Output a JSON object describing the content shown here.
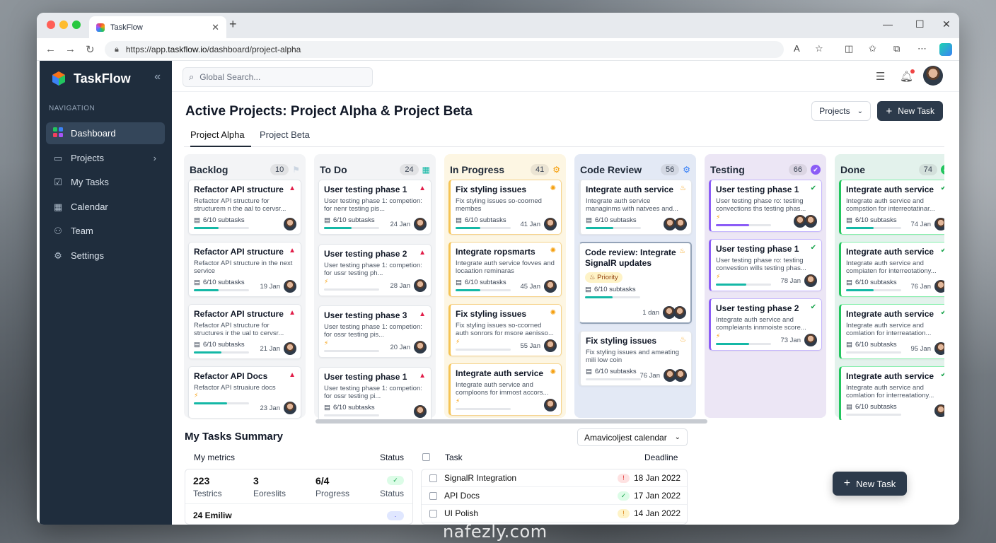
{
  "browser": {
    "tab_title": "TaskFlow",
    "url_prefix": "https://app.",
    "url_domain": "taskflow.io",
    "url_path": "/dashboard/project-alpha"
  },
  "sidebar": {
    "brand": "TaskFlow",
    "section_label": "NAVIGATION",
    "items": [
      {
        "label": "Dashboard",
        "icon": "grid-icon"
      },
      {
        "label": "Projects",
        "icon": "folder-icon"
      },
      {
        "label": "My Tasks",
        "icon": "checkbox-icon"
      },
      {
        "label": "Calendar",
        "icon": "calendar-icon"
      },
      {
        "label": "Team",
        "icon": "people-icon"
      },
      {
        "label": "Settings",
        "icon": "gear-icon"
      }
    ]
  },
  "topbar": {
    "search_placeholder": "Global Search..."
  },
  "page": {
    "title": "Active Projects: Project Alpha & Project Beta",
    "projects_select": "Projects",
    "new_task": "New Task",
    "tabs": [
      "Project Alpha",
      "Project Beta"
    ]
  },
  "columns": [
    {
      "title": "Backlog",
      "count": "10",
      "accent": "#f3f4f6",
      "cards": [
        {
          "title": "Refactor API structure",
          "desc": "Refactor API structure for structurem n the aal to cervsr...",
          "sub": "6/10 subtasks",
          "date": "",
          "progress": 0.45
        },
        {
          "title": "Refactor API structure",
          "desc": "Refactor API structure in the next service",
          "sub": "6/10 subtasks",
          "date": "19 Jan",
          "progress": 0.45
        },
        {
          "title": "Refactor API structure",
          "desc": "Refactor API structure for structures ir the ual to cervsr...",
          "sub": "6/10 subtasks",
          "date": "21 Jan",
          "progress": 0.5
        },
        {
          "title": "Refactor API Docs",
          "desc": "Refactor API struaiure docs",
          "sub": "",
          "date": "23 Jan",
          "progress": 0.6
        }
      ]
    },
    {
      "title": "To Do",
      "count": "24",
      "accent": "#f3f4f6",
      "cards": [
        {
          "title": "User testing phase 1",
          "desc": "User testing phase 1: competion: for nenr testing pis...",
          "sub": "6/10 subtasks",
          "date": "24 Jan",
          "progress": 0.5
        },
        {
          "title": "User testing phase 2",
          "desc": "User testing phase 1: competion: for ussr testing ph...",
          "sub": "",
          "date": "28 Jan",
          "progress": 0
        },
        {
          "title": "User testing phase 3",
          "desc": "User testing phase 1: competion: for ossr testing pis...",
          "sub": "",
          "date": "20 Jan",
          "progress": 0
        },
        {
          "title": "User testing phase 1",
          "desc": "User testing phase 1: competion: for ossr testing pi...",
          "sub": "6/10 subtasks",
          "date": "",
          "progress": 0
        }
      ]
    },
    {
      "title": "In Progress",
      "count": "41",
      "accent": "#fdf6e3",
      "cards": [
        {
          "title": "Fix styling issues",
          "desc": "Fix styling issues so-coorned membes",
          "sub": "6/10 subtasks",
          "date": "41 Jan",
          "progress": 0.45
        },
        {
          "title": "Integrate ropsmarts",
          "desc": "Integrate auth service fovves and locaation reminaras",
          "sub": "6/10 subtasks",
          "date": "45 Jan",
          "progress": 0.45
        },
        {
          "title": "Fix styling issues",
          "desc": "Fix styling issues so-ccorned auth sonrors for msore aenisso...",
          "sub": "",
          "date": "55 Jan",
          "progress": 0
        },
        {
          "title": "Integrate auth service",
          "desc": "Integrate auth service and comploons for immost accors...",
          "sub": "",
          "date": "",
          "progress": 0
        }
      ]
    },
    {
      "title": "Code Review",
      "count": "56",
      "accent": "#e3e9f5",
      "cards": [
        {
          "title": "Integrate auth service",
          "desc": "Integrate auth service managinms with natvees and...",
          "sub": "6/10 subtasks",
          "date": "",
          "progress": 0.5
        },
        {
          "title": "Code review: Integrate SignalR updates",
          "desc": "",
          "priority": "Priority",
          "sub": "6/10 subtasks",
          "date": "1 dan",
          "progress": 0.5
        },
        {
          "title": "Fix styling issues",
          "desc": "Fix styling issues and ameating mili low coin",
          "sub": "6/10 subtasks",
          "date": "76 Jan",
          "progress": 0
        }
      ]
    },
    {
      "title": "Testing",
      "count": "66",
      "accent": "#ece6f5",
      "cards": [
        {
          "title": "User testing phase 1",
          "desc": "User testing phase ro: testing convections ths testing phas...",
          "sub": "",
          "date": "",
          "progress": 0.6
        },
        {
          "title": "User testing phase 1",
          "desc": "User testing phase ro: testing convestion wills testing phas...",
          "sub": "",
          "date": "78 Jan",
          "progress": 0.55
        },
        {
          "title": "User testing phase 2",
          "desc": "Integrate auth service and compleiants innmoiste score...",
          "sub": "",
          "date": "73 Jan",
          "progress": 0.6
        }
      ]
    },
    {
      "title": "Done",
      "count": "74",
      "accent": "#e3f2ec",
      "cards": [
        {
          "title": "Integrate auth service",
          "desc": "Integrate auth service and compstion for interreotatinar...",
          "sub": "6/10 subtasks",
          "date": "74 Jan",
          "progress": 0.5
        },
        {
          "title": "Integrate auth service",
          "desc": "Integrate auth service and compiaten for interreotationy...",
          "sub": "6/10 subtasks",
          "date": "76 Jan",
          "progress": 0.5
        },
        {
          "title": "Integrate auth service",
          "desc": "Integrate auth service and comlation for interreatation...",
          "sub": "6/10 subtasks",
          "date": "95 Jan",
          "progress": 0
        },
        {
          "title": "Integrate auth service",
          "desc": "Integrate auth service and comlation for interreatationy...",
          "sub": "6/10 subtasks",
          "date": "",
          "progress": 0
        }
      ]
    }
  ],
  "summary": {
    "title": "My Tasks Summary",
    "calendar_select": "Amavicoljest calendar",
    "metrics_header": "My metrics",
    "status_header": "Status",
    "metrics": [
      {
        "value": "223",
        "label": "Testrics"
      },
      {
        "value": "3",
        "label": "Eoreslits"
      },
      {
        "value": "6/4",
        "label": "Progress"
      }
    ],
    "status_label": "Status",
    "extra_row": "24 Emiliw",
    "task_header": "Task",
    "deadline_header": "Deadline",
    "tasks": [
      {
        "task": "SignalR Integration",
        "deadline": "18 Jan 2022",
        "status": "overdue"
      },
      {
        "task": "API Docs",
        "deadline": "17 Jan 2022",
        "status": "done"
      },
      {
        "task": "UI Polish",
        "deadline": "14 Jan 2022",
        "status": "warning"
      }
    ]
  },
  "fab": {
    "label": "New Task"
  },
  "watermark": "nafezly.com"
}
